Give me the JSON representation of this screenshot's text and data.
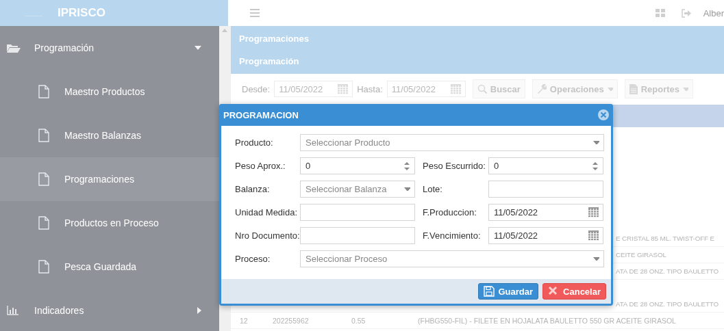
{
  "header": {
    "brand": "IPRISCO",
    "user": "Alber"
  },
  "sidebar": {
    "items": [
      {
        "label": "Programación",
        "kind": "group",
        "expanded": true,
        "children": [
          {
            "label": "Maestro Productos",
            "selected": false
          },
          {
            "label": "Maestro Balanzas",
            "selected": false
          },
          {
            "label": "Programaciones",
            "selected": true
          },
          {
            "label": "Productos en Proceso",
            "selected": false
          },
          {
            "label": "Pesca Guardada",
            "selected": false
          }
        ]
      },
      {
        "label": "Indicadores",
        "kind": "chart",
        "expanded": false
      }
    ]
  },
  "page": {
    "title": "Programaciones",
    "subtitle": "Programación"
  },
  "toolbar": {
    "from_label": "Desde:",
    "from_value": "11/05/2022",
    "to_label": "Hasta:",
    "to_value": "11/05/2022",
    "buttons": [
      {
        "label": "Buscar",
        "kind": "search",
        "dropdown": false
      },
      {
        "label": "Operaciones",
        "kind": "wrench",
        "dropdown": true
      },
      {
        "label": "Reportes",
        "kind": "report",
        "dropdown": true
      }
    ]
  },
  "table": {
    "rows": [
      {
        "kind": "partial",
        "cells": [
          "E CRISTAL 85 ML. TWIST-OFF E"
        ]
      },
      {
        "kind": "partial",
        "cells": [
          "CEITE GIRASOL"
        ]
      },
      {
        "kind": "partial",
        "cells": [
          "ATA DE 28 ONZ. TIPO BAULETTO"
        ]
      },
      {
        "kind": "partial",
        "cells": [
          "ATA DE 28 ONZ. TIPO BAULETTO"
        ]
      },
      {
        "kind": "full",
        "cells": [
          "12",
          "202255962",
          "0.55",
          "(FHBG550-FIL) - FILETE EN HOJALATA BAULETTO 550 GR ACEITE GIRASOL"
        ]
      }
    ]
  },
  "modal": {
    "title": "PROGRAMACION",
    "rows": [
      [
        {
          "label": "Producto:",
          "kind": "select",
          "placeholder": "Seleccionar Producto"
        }
      ],
      [
        {
          "label": "Peso Aprox.:",
          "kind": "number",
          "value": "0"
        },
        {
          "label": "Peso Escurrido:",
          "kind": "number",
          "value": "0"
        }
      ],
      [
        {
          "label": "Balanza:",
          "kind": "select",
          "placeholder": "Seleccionar Balanza"
        },
        {
          "label": "Lote:",
          "kind": "text"
        }
      ],
      [
        {
          "label": "Unidad Medida:",
          "kind": "text"
        },
        {
          "label": "F.Produccion:",
          "kind": "date",
          "value": "11/05/2022"
        }
      ],
      [
        {
          "label": "Nro Documento:",
          "kind": "text"
        },
        {
          "label": "F.Vencimiento:",
          "kind": "date",
          "value": "11/05/2022"
        }
      ],
      [
        {
          "label": "Proceso:",
          "kind": "select",
          "placeholder": "Seleccionar Proceso"
        }
      ]
    ],
    "buttons": [
      {
        "label": "Guardar",
        "kind": "save"
      },
      {
        "label": "Cancelar",
        "kind": "cancel"
      }
    ]
  }
}
